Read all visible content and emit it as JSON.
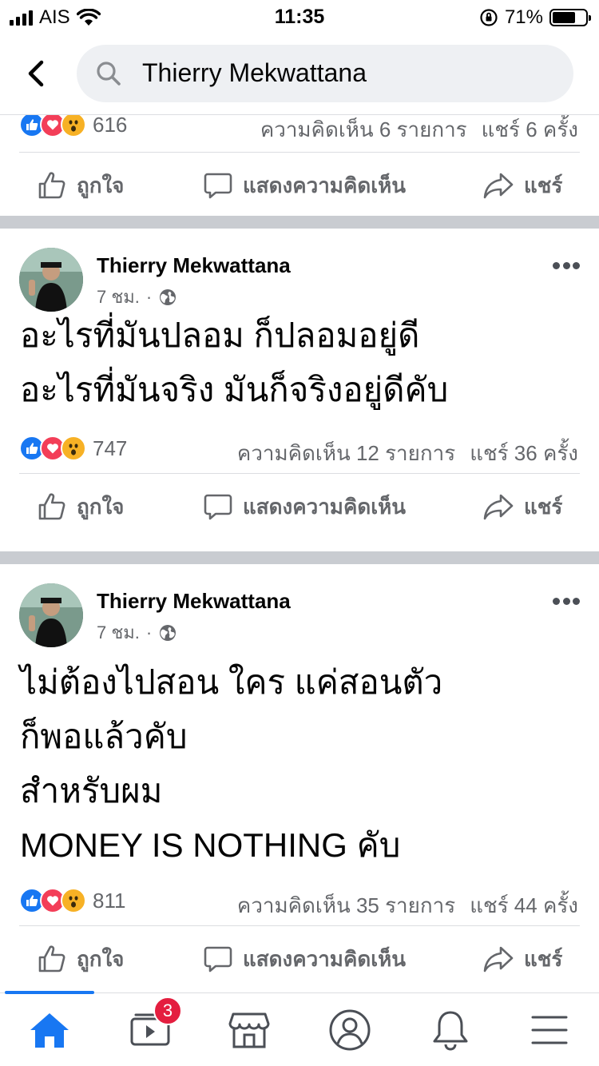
{
  "status_bar": {
    "carrier": "AIS",
    "time": "11:35",
    "battery": "71%",
    "battery_level": 0.71
  },
  "search": {
    "query": "Thierry Mekwattana"
  },
  "top_post": {
    "reaction_count": "616",
    "comments": "ความคิดเห็น 6 รายการ",
    "shares": "แชร์ 6 ครั้ง"
  },
  "actions": {
    "like": "ถูกใจ",
    "comment": "แสดงความคิดเห็น",
    "share": "แชร์"
  },
  "posts": [
    {
      "author": "Thierry Mekwattana",
      "time": "7 ชม.",
      "dot": "·",
      "lines": [
        "อะไรที่มันปลอม ก็ปลอมอยู่ดี",
        "อะไรที่มันจริง มันก็จริงอยู่ดีคับ"
      ],
      "reaction_count": "747",
      "comments": "ความคิดเห็น 12 รายการ",
      "shares": "แชร์ 36 ครั้ง"
    },
    {
      "author": "Thierry Mekwattana",
      "time": "7 ชม.",
      "dot": "·",
      "lines": [
        "ไม่ต้องไปสอน ใคร แค่สอนตัว",
        "ก็พอแล้วคับ",
        "สำหรับผม",
        "MONEY IS NOTHING คับ"
      ],
      "reaction_count": "811",
      "comments": "ความคิดเห็น 35 รายการ",
      "shares": "แชร์ 44 ครั้ง"
    }
  ],
  "tab_bar": {
    "video_badge": "3",
    "active_tab": "home"
  },
  "colors": {
    "accent": "#1877f2",
    "badge": "#e41e3f",
    "divider": "#c9ccd1"
  }
}
